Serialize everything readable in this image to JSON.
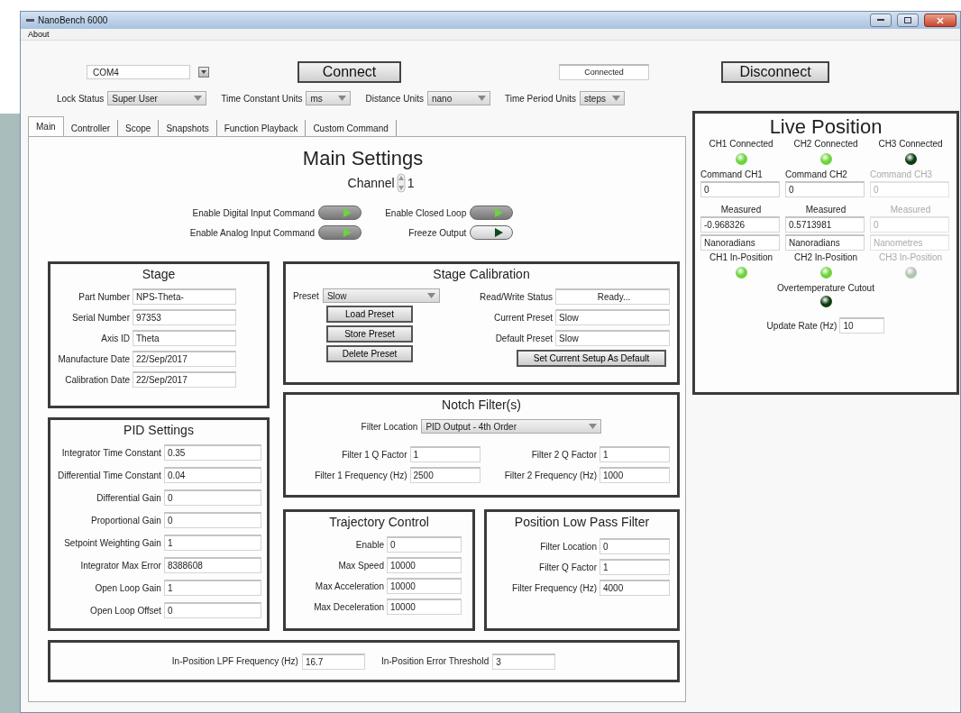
{
  "window": {
    "title": "NanoBench 6000"
  },
  "menu": [
    "About"
  ],
  "connection": {
    "port": "COM4",
    "connect_button": "Connect",
    "status": "Connected",
    "disconnect_button": "Disconnect"
  },
  "units": [
    {
      "label": "Lock Status",
      "value": "Super User"
    },
    {
      "label": "Time Constant Units",
      "value": "ms"
    },
    {
      "label": "Distance Units",
      "value": "nano"
    },
    {
      "label": "Time Period Units",
      "value": "steps"
    }
  ],
  "tabs": [
    {
      "label": "Main",
      "selected": true
    },
    {
      "label": "Controller",
      "selected": false
    },
    {
      "label": "Scope",
      "selected": false
    },
    {
      "label": "Snapshots",
      "selected": false
    },
    {
      "label": "Function Playback",
      "selected": false
    },
    {
      "label": "Custom Command",
      "selected": false
    }
  ],
  "main_settings": {
    "title": "Main Settings",
    "channel_label": "Channel",
    "channel": "1",
    "toggles": [
      {
        "label": "Enable Digital Input Command",
        "on": true
      },
      {
        "label": "Enable Closed Loop",
        "on": true
      },
      {
        "label": "Enable Analog Input Command",
        "on": true
      },
      {
        "label": "Freeze Output",
        "on": false
      }
    ]
  },
  "stage": {
    "title": "Stage",
    "fields": [
      {
        "label": "Part Number",
        "value": "NPS-Theta-"
      },
      {
        "label": "Serial Number",
        "value": "97353"
      },
      {
        "label": "Axis ID",
        "value": "Theta"
      },
      {
        "label": "Manufacture Date",
        "value": "22/Sep/2017"
      },
      {
        "label": "Calibration Date",
        "value": "22/Sep/2017"
      }
    ]
  },
  "stage_calibration": {
    "title": "Stage Calibration",
    "preset_label": "Preset",
    "preset": "Slow",
    "buttons": [
      "Load Preset",
      "Store Preset",
      "Delete Preset"
    ],
    "fields": [
      {
        "label": "Read/Write Status",
        "value": "Ready..."
      },
      {
        "label": "Current Preset",
        "value": "Slow"
      },
      {
        "label": "Default Preset",
        "value": "Slow"
      }
    ],
    "default_button": "Set Current Setup As Default"
  },
  "notch_filters": {
    "title": "Notch Filter(s)",
    "location_label": "Filter Location",
    "location": "PID Output - 4th Order",
    "fields": [
      {
        "label": "Filter 1 Q Factor",
        "value": "1"
      },
      {
        "label": "Filter 2 Q Factor",
        "value": "1"
      },
      {
        "label": "Filter 1 Frequency (Hz)",
        "value": "2500"
      },
      {
        "label": "Filter 2 Frequency (Hz)",
        "value": "1000"
      }
    ]
  },
  "pid_settings": {
    "title": "PID Settings",
    "fields": [
      {
        "label": "Integrator Time Constant",
        "value": "0.35"
      },
      {
        "label": "Differential Time Constant",
        "value": "0.04"
      },
      {
        "label": "Differential Gain",
        "value": "0"
      },
      {
        "label": "Proportional Gain",
        "value": "0"
      },
      {
        "label": "Setpoint Weighting Gain",
        "value": "1"
      },
      {
        "label": "Integrator Max Error",
        "value": "8388608"
      },
      {
        "label": "Open Loop Gain",
        "value": "1"
      },
      {
        "label": "Open Loop Offset",
        "value": "0"
      }
    ]
  },
  "trajectory_control": {
    "title": "Trajectory Control",
    "fields": [
      {
        "label": "Enable",
        "value": "0"
      },
      {
        "label": "Max Speed",
        "value": "10000"
      },
      {
        "label": "Max Acceleration",
        "value": "10000"
      },
      {
        "label": "Max Deceleration",
        "value": "10000"
      }
    ]
  },
  "position_low_pass_filter": {
    "title": "Position Low Pass Filter",
    "fields": [
      {
        "label": "Filter Location",
        "value": "0"
      },
      {
        "label": "Filter Q Factor",
        "value": "1"
      },
      {
        "label": "Filter Frequency (Hz)",
        "value": "4000"
      }
    ]
  },
  "in_position": [
    {
      "label": "In-Position LPF Frequency (Hz)",
      "value": "16.7"
    },
    {
      "label": "In-Position Error Threshold",
      "value": "3"
    }
  ],
  "live_position": {
    "title": "Live Position",
    "channels": [
      {
        "connected_label": "CH1 Connected",
        "connected": true,
        "command_label": "Command CH1",
        "command": "0",
        "measured_label": "Measured",
        "measured": "-0.968326",
        "unit": "Nanoradians",
        "in_position_label": "CH1 In-Position",
        "in_position": true,
        "disabled": false
      },
      {
        "connected_label": "CH2 Connected",
        "connected": true,
        "command_label": "Command CH2",
        "command": "0",
        "measured_label": "Measured",
        "measured": "0.5713981",
        "unit": "Nanoradians",
        "in_position_label": "CH2 In-Position",
        "in_position": true,
        "disabled": false
      },
      {
        "connected_label": "CH3 Connected",
        "connected": false,
        "command_label": "Command CH3",
        "command": "0",
        "measured_label": "Measured",
        "measured": "0",
        "unit": "Nanometres",
        "in_position_label": "CH3 In-Position",
        "in_position": false,
        "disabled": true
      }
    ],
    "overtemperature": {
      "label": "Overtemperature Cutout",
      "on": false
    },
    "update_rate": {
      "label": "Update Rate (Hz)",
      "value": "10"
    }
  }
}
